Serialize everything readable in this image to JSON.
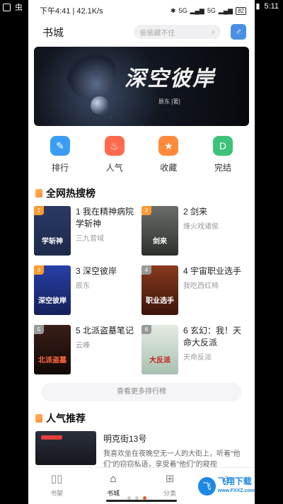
{
  "outer_status": {
    "left_icon": "ch-icon",
    "time": "5:11"
  },
  "status_bar": {
    "time": "下午4:41 | 42.1K/s",
    "network": "5G",
    "network2": "5G",
    "battery": "82"
  },
  "header": {
    "title": "书城",
    "search_placeholder": "偷偷藏不住",
    "gender_icon": "♂"
  },
  "banner": {
    "title": "深空彼岸",
    "subtitle": "辰东 [著]"
  },
  "categories": [
    {
      "label": "排行",
      "icon": "list-icon",
      "glyph": "✎",
      "color": "#3b9cf3"
    },
    {
      "label": "人气",
      "icon": "fire-icon",
      "glyph": "♨",
      "color": "#ff6a4d"
    },
    {
      "label": "收藏",
      "icon": "star-icon",
      "glyph": "★",
      "color": "#ff8a3c"
    },
    {
      "label": "完结",
      "icon": "done-icon",
      "glyph": "D",
      "color": "#3ec27a"
    }
  ],
  "hot_section": {
    "title": "全网热搜榜"
  },
  "hot_books": [
    {
      "rank": "1",
      "title": "1 我在精神病院学斩神",
      "author": "三九音域",
      "cover_text": "学斩神",
      "cover_color": "#1d2a4a",
      "rank_color": "#ff9a2e"
    },
    {
      "rank": "2",
      "title": "2 剑来",
      "author": "烽火戏诸侯",
      "cover_text": "剑来",
      "cover_color": "#4a4e4a",
      "rank_color": "#ff9a2e"
    },
    {
      "rank": "3",
      "title": "3 深空彼岸",
      "author": "辰东",
      "cover_text": "深空彼岸",
      "cover_color": "#1b2a7a",
      "rank_color": "#ff9a2e"
    },
    {
      "rank": "4",
      "title": "4 宇宙职业选手",
      "author": "我吃西红柿",
      "cover_text": "职业选手",
      "cover_color": "#5a1e12",
      "rank_color": "#999999"
    },
    {
      "rank": "5",
      "title": "5 北派盗墓笔记",
      "author": "云峰",
      "cover_text": "北派盗墓",
      "cover_color": "#2a1410",
      "rank_color": "#999999"
    },
    {
      "rank": "6",
      "title": "6 玄幻：我！天命大反派",
      "author": "天命反派",
      "cover_text": "大反派",
      "cover_color": "#d8e4d8",
      "rank_color": "#999999"
    }
  ],
  "more_button": "查看更多排行榜",
  "rec_section": {
    "title": "人气推荐"
  },
  "recommend": {
    "title": "明克街13号",
    "desc": "我喜欢坐在夜晚空无一人的大街上，听着\"他们\"的窃窃私语，享受着\"他们\"的窥视"
  },
  "tabs": [
    {
      "label": "书架",
      "icon": "book-icon",
      "glyph": "📖",
      "active": false
    },
    {
      "label": "书城",
      "icon": "home-icon",
      "glyph": "⌂",
      "active": true
    },
    {
      "label": "分类",
      "icon": "grid-icon",
      "glyph": "⊞",
      "active": false
    },
    {
      "label": "",
      "icon": "user-icon",
      "glyph": "○",
      "active": false
    }
  ],
  "watermark": {
    "title": "飞翔下载",
    "url": "www.FXXZ.com"
  }
}
